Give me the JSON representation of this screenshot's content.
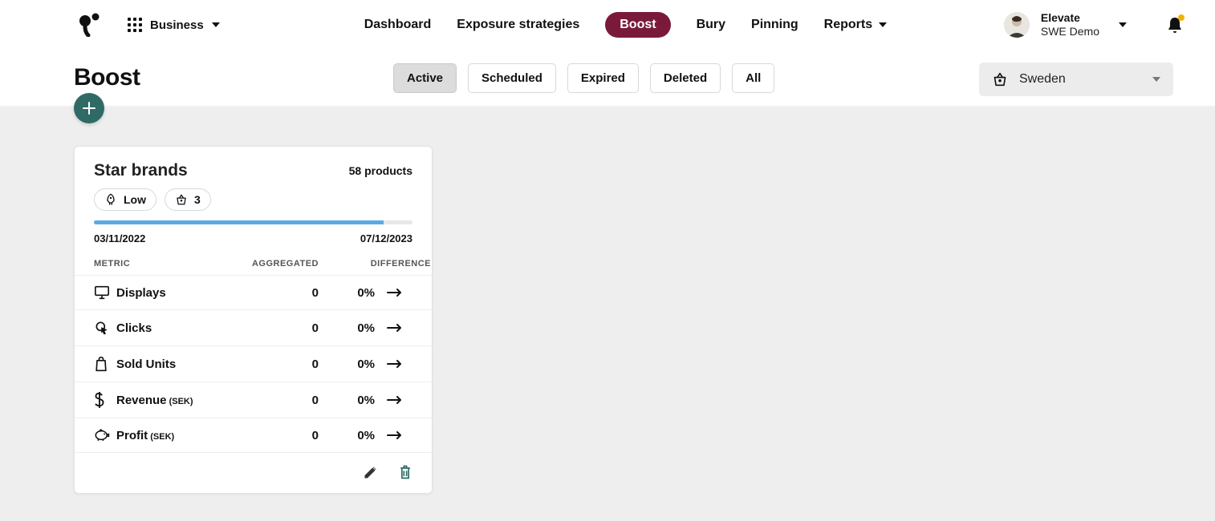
{
  "header": {
    "apps_label": "Business",
    "nav": {
      "dashboard": "Dashboard",
      "exposure": "Exposure strategies",
      "boost": "Boost",
      "bury": "Bury",
      "pinning": "Pinning",
      "reports": "Reports"
    },
    "account": {
      "name": "Elevate",
      "sub": "SWE Demo"
    }
  },
  "subheader": {
    "title": "Boost",
    "filters": {
      "active": "Active",
      "scheduled": "Scheduled",
      "expired": "Expired",
      "deleted": "Deleted",
      "all": "All"
    },
    "market": "Sweden"
  },
  "card": {
    "title": "Star brands",
    "product_count": "58 products",
    "chip_level": "Low",
    "chip_basket": "3",
    "date_start": "03/11/2022",
    "date_end": "07/12/2023",
    "columns": {
      "metric": "METRIC",
      "aggregated": "AGGREGATED",
      "difference": "DIFFERENCE"
    },
    "rows": [
      {
        "label": "Displays",
        "sub": "",
        "agg": "0",
        "diff": "0%"
      },
      {
        "label": "Clicks",
        "sub": "",
        "agg": "0",
        "diff": "0%"
      },
      {
        "label": "Sold Units",
        "sub": "",
        "agg": "0",
        "diff": "0%"
      },
      {
        "label": "Revenue",
        "sub": " (SEK)",
        "agg": "0",
        "diff": "0%"
      },
      {
        "label": "Profit",
        "sub": " (SEK)",
        "agg": "0",
        "diff": "0%"
      }
    ]
  },
  "colors": {
    "nav_active_bg": "#7a1a3a",
    "fab_bg": "#2f6a66",
    "progress": "#5aa9e6"
  }
}
